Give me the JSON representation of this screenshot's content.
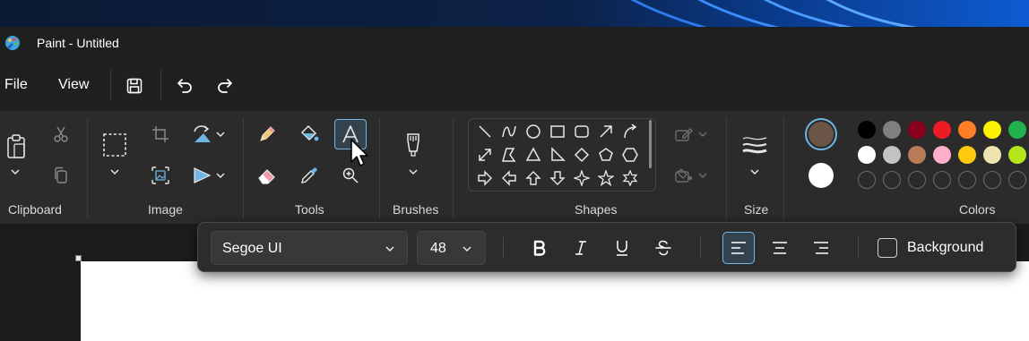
{
  "window": {
    "title": "Paint - Untitled"
  },
  "menu": {
    "file": "File",
    "view": "View"
  },
  "ribbon": {
    "groups": {
      "clipboard": "Clipboard",
      "image": "Image",
      "tools": "Tools",
      "brushes": "Brushes",
      "shapes": "Shapes",
      "size": "Size",
      "colors": "Colors"
    }
  },
  "colors": {
    "primary": "#6b5546",
    "secondary": "#ffffff",
    "palette_row1": [
      "#000000",
      "#7f7f7f",
      "#88001b",
      "#ec1c24",
      "#ff7f27",
      "#fff200",
      "#22b14c"
    ],
    "palette_row2": [
      "#ffffff",
      "#c3c3c3",
      "#b97a57",
      "#ffaec9",
      "#ffc90e",
      "#efe4b0",
      "#b5e61d"
    ]
  },
  "text_toolbar": {
    "font_family": "Segoe UI",
    "font_size": "48",
    "background_label": "Background",
    "background_checked": false
  }
}
